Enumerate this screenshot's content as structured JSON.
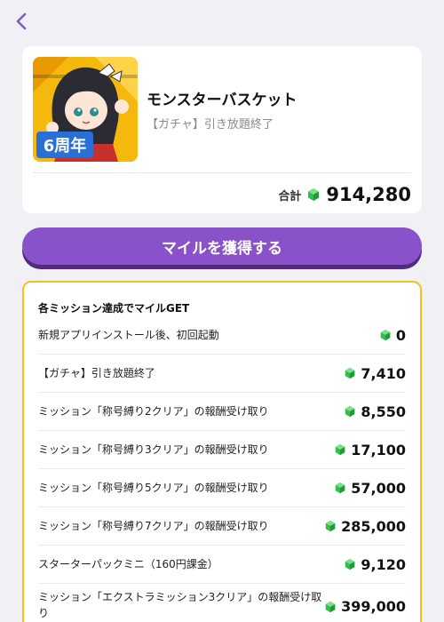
{
  "nav": {
    "back_icon": "chevron-left-icon"
  },
  "app": {
    "title": "モンスターバスケット",
    "subtitle": "【ガチャ】引き放題終了",
    "icon_text": "6周年"
  },
  "total": {
    "label": "合計",
    "value": "914,280"
  },
  "cta": {
    "label": "マイルを獲得する"
  },
  "missions": {
    "heading": "各ミッション達成でマイルGET",
    "items": [
      {
        "label": "新規アプリインストール後、初回起動",
        "reward": "0"
      },
      {
        "label": "【ガチャ】引き放題終了",
        "reward": "7,410"
      },
      {
        "label": "ミッション「称号縛り2クリア」の報酬受け取り",
        "reward": "8,550"
      },
      {
        "label": "ミッション「称号縛り3クリア」の報酬受け取り",
        "reward": "17,100"
      },
      {
        "label": "ミッション「称号縛り5クリア」の報酬受け取り",
        "reward": "57,000"
      },
      {
        "label": "ミッション「称号縛り7クリア」の報酬受け取り",
        "reward": "285,000"
      },
      {
        "label": "スターターパックミニ（160円課金）",
        "reward": "9,120"
      },
      {
        "label": "ミッション「エクストラミッション3クリア」の報酬受け取り",
        "reward": "399,000"
      }
    ]
  },
  "colors": {
    "accent": "#8a52c8",
    "accent_shadow": "#4f2c80",
    "border": "#f2c21b",
    "gem": "#2fbf4a"
  }
}
